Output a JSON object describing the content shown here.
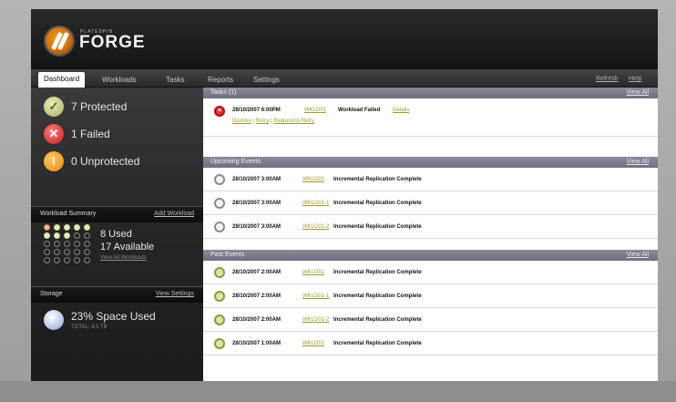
{
  "brand": {
    "small": "PLATESPIN",
    "name": "FORGE"
  },
  "nav": {
    "tabs": [
      "Dashboard",
      "Workloads",
      "Tasks",
      "Reports",
      "Settings"
    ],
    "right": [
      "Refresh",
      "Help"
    ]
  },
  "summary": {
    "protected": "7 Protected",
    "failed": "1 Failed",
    "unprotected": "0 Unprotected"
  },
  "workload_summary": {
    "title": "Workload Summary",
    "link": "Add Workload",
    "used": "8 Used",
    "available": "17 Available",
    "view_link": "View All Workloads"
  },
  "storage": {
    "title": "Storage",
    "link": "View Settings",
    "used": "23% Space Used",
    "sub": "TOTAL: 4.5 TB"
  },
  "tasks": {
    "title": "Tasks (1)",
    "link": "View All",
    "item": {
      "date": "28/10/2007 6:00PM",
      "host": "WKLD01",
      "message": "Workload Failed",
      "details": "Details",
      "actions": [
        "Dismiss",
        "Retry",
        "Request to Retry"
      ]
    }
  },
  "upcoming": {
    "title": "Upcoming Events",
    "link": "View All",
    "rows": [
      {
        "date": "28/10/2007 3:00AM",
        "host": "WKLD01",
        "message": "Incremental Replication Complete"
      },
      {
        "date": "28/10/2007 3:00AM",
        "host": "WKLD01-1",
        "message": "Incremental Replication Complete"
      },
      {
        "date": "28/10/2007 3:00AM",
        "host": "WKLD01-2",
        "message": "Incremental Replication Complete"
      }
    ]
  },
  "past": {
    "title": "Past Events",
    "link": "View All",
    "rows": [
      {
        "date": "28/10/2007 2:00AM",
        "host": "WKLD01",
        "message": "Incremental Replication Complete"
      },
      {
        "date": "28/10/2007 2:00AM",
        "host": "WKLD01-1",
        "message": "Incremental Replication Complete"
      },
      {
        "date": "28/10/2007 2:00AM",
        "host": "WKLD01-2",
        "message": "Incremental Replication Complete"
      },
      {
        "date": "28/10/2007 1:00AM",
        "host": "WKLD01",
        "message": "Incremental Replication Complete"
      }
    ]
  },
  "colors": {
    "accent": "#9a9a30",
    "failed": "#c81818",
    "warning": "#e88a10",
    "ok": "#dde4a8"
  }
}
